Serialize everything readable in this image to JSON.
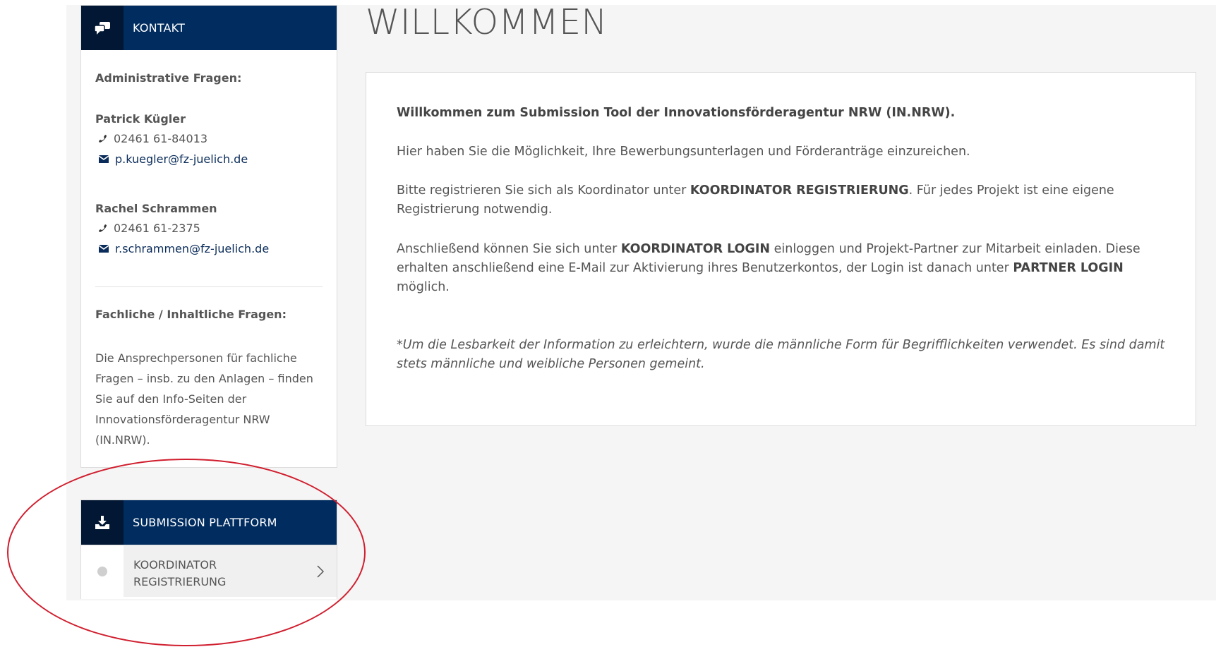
{
  "contact": {
    "header_title": "KONTAKT",
    "admin_label": "Administrative Fragen:",
    "persons": [
      {
        "name": "Patrick Kügler",
        "phone": "02461 61-84013",
        "email": "p.kuegler@fz-juelich.de"
      },
      {
        "name": "Rachel Schrammen",
        "phone": "02461 61-2375",
        "email": "r.schrammen@fz-juelich.de"
      }
    ],
    "technical_label": "Fachliche / Inhaltliche Fragen:",
    "technical_text_lines": [
      "Die Ansprechpersonen für fachliche",
      "Fragen – insb. zu den Anlagen – finden",
      "Sie auf den Info-Seiten der",
      "Innovationsförderagentur NRW",
      "(IN.NRW)."
    ]
  },
  "submission": {
    "header_title": "SUBMISSION PLATTFORM",
    "items": [
      {
        "label_line1": "KOORDINATOR",
        "label_line2": "REGISTRIERUNG"
      }
    ]
  },
  "main": {
    "title": "WILLKOMMEN",
    "intro_bold": "Willkommen zum Submission Tool der Innovationsförderagentur NRW (IN.NRW).",
    "p1": "Hier haben Sie die Möglichkeit, Ihre Bewerbungsunterlagen und Förderanträge einzureichen.",
    "p2_a": "Bitte registrieren Sie sich als Koordinator unter ",
    "p2_b": "KOORDINATOR REGISTRIERUNG",
    "p2_c": ". Für jedes Projekt ist eine eigene Registrierung notwendig.",
    "p3_a": "Anschließend können Sie sich unter ",
    "p3_b": "KOORDINATOR LOGIN",
    "p3_c": " einloggen und Projekt-Partner zur Mitarbeit einladen. Diese erhalten anschließend eine E-Mail zur Aktivierung ihres Benutzerkontos, der Login ist danach unter ",
    "p3_d": "PARTNER LOGIN",
    "p3_e": " möglich.",
    "note": "*Um die Lesbarkeit der Information zu erleichtern, wurde die männliche Form für Begrifflichkeiten verwendet. Es sind damit stets männliche und weibliche Personen gemeint."
  },
  "colors": {
    "header_bg": "#002c5f",
    "header_icon_bg": "#011733",
    "highlight": "#d01e2e"
  },
  "icons": [
    "chat-icon",
    "phone-icon",
    "mail-icon",
    "download-tray-icon",
    "bullet-dot-icon",
    "chevron-right-icon"
  ]
}
